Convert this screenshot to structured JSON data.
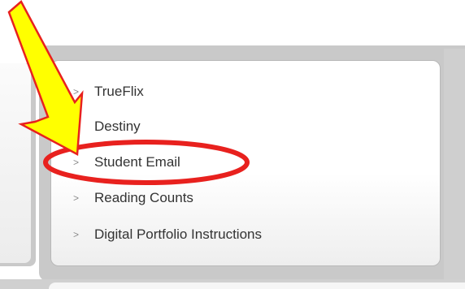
{
  "menu": {
    "items": [
      {
        "label": "TrueFlix",
        "chevron": ">"
      },
      {
        "label": "Destiny",
        "chevron": ">"
      },
      {
        "label": "Student Email",
        "chevron": ">"
      },
      {
        "label": "Reading Counts",
        "chevron": ">"
      },
      {
        "label": "Digital Portfolio Instructions",
        "chevron": ">"
      }
    ]
  },
  "annotations": {
    "arrow_icon": "arrow-down-right-icon",
    "arrow_fill": "#ffff00",
    "arrow_stroke": "#e8211e",
    "highlight_icon": "ellipse-highlight-icon",
    "highlight_color": "#e8211e",
    "highlighted_item": "Student Email"
  }
}
